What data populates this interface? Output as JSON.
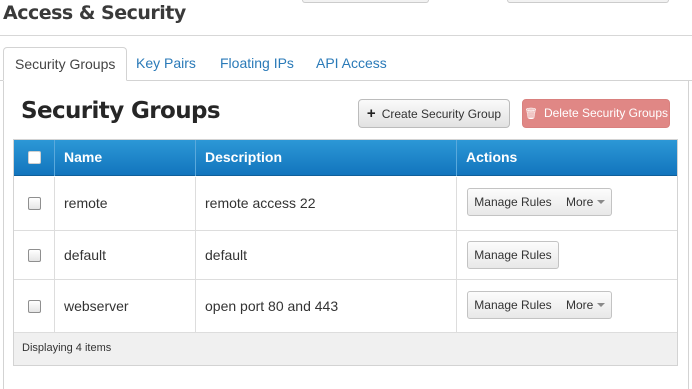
{
  "page": {
    "title": "Access & Security"
  },
  "tabs": [
    {
      "label": "Security Groups",
      "active": true
    },
    {
      "label": "Key Pairs",
      "active": false
    },
    {
      "label": "Floating IPs",
      "active": false
    },
    {
      "label": "API Access",
      "active": false
    }
  ],
  "section": {
    "title": "Security Groups"
  },
  "actions": {
    "create_label": "Create Security Group",
    "delete_label": "Delete Security Groups"
  },
  "table": {
    "columns": [
      "Name",
      "Description",
      "Actions"
    ],
    "rows": [
      {
        "name": "remote",
        "description": "remote access 22",
        "manage_label": "Manage Rules",
        "more_label": "More"
      },
      {
        "name": "default",
        "description": "default",
        "manage_label": "Manage Rules"
      },
      {
        "name": "webserver",
        "description": "open port 80 and 443",
        "manage_label": "Manage Rules",
        "more_label": "More"
      }
    ],
    "footer": "Displaying 4 items"
  },
  "colors": {
    "header_blue": "#1a86c9",
    "link_blue": "#2a7ab8",
    "danger": "#e08785"
  }
}
